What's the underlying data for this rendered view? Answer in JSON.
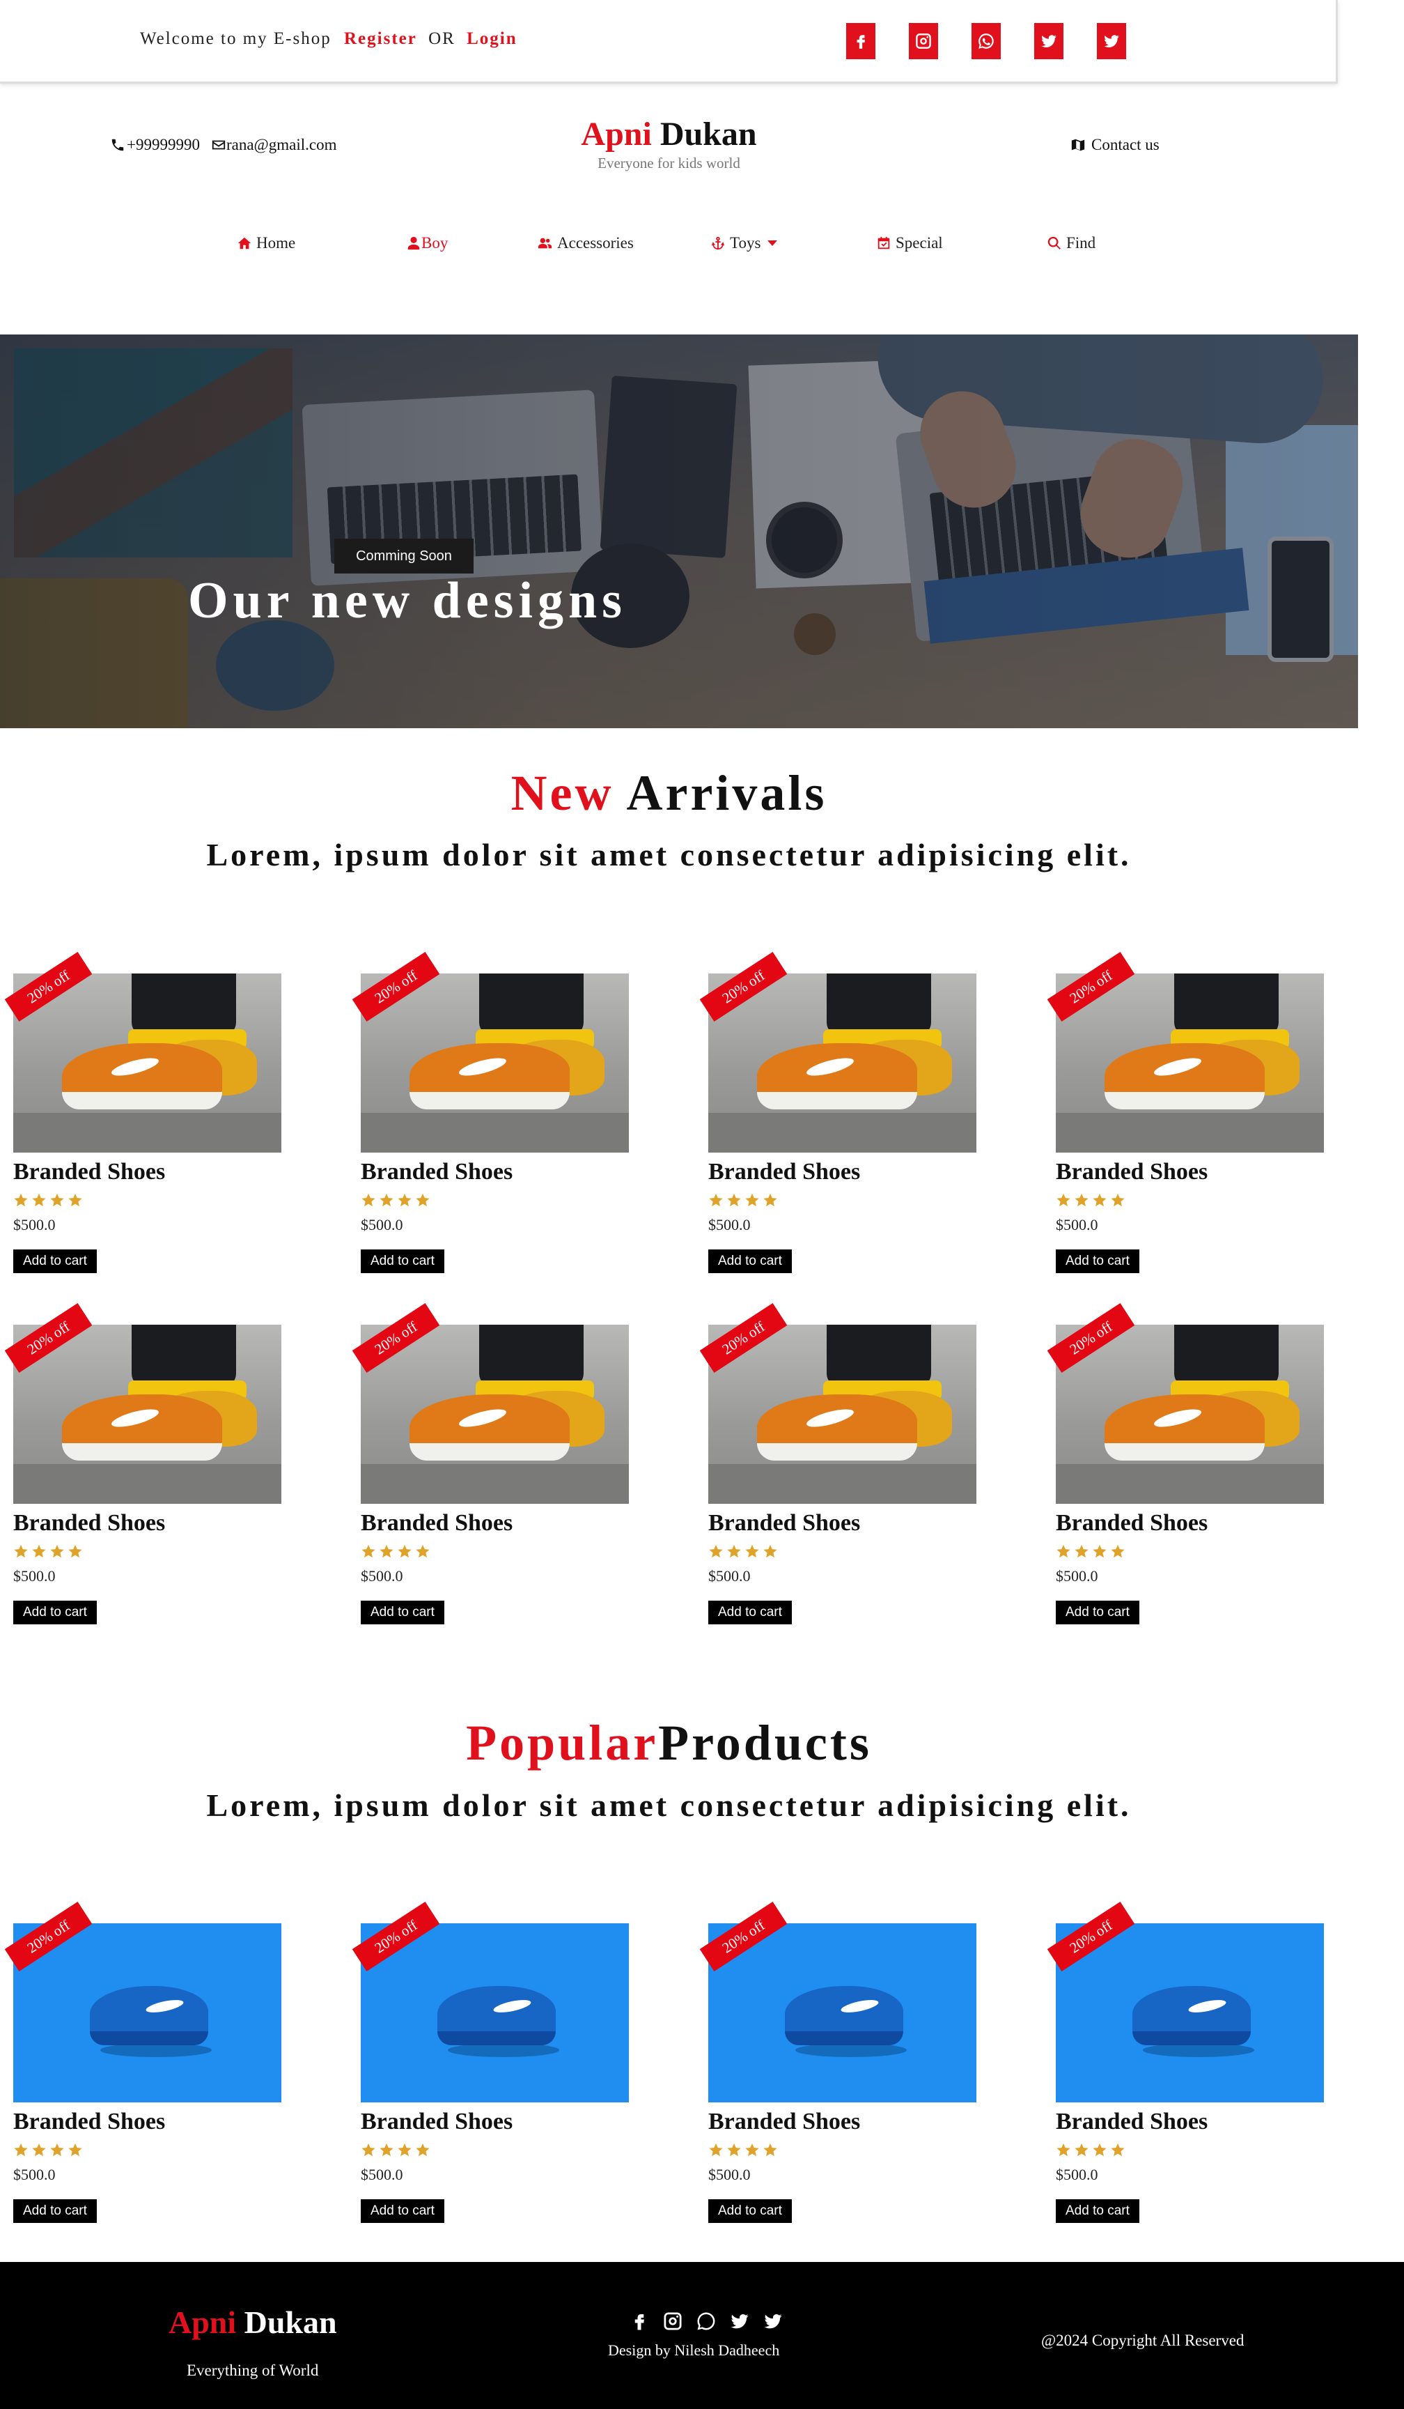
{
  "topbar": {
    "welcome": "Welcome to my E-shop",
    "register": "Register",
    "or": "OR",
    "login": "Login",
    "socials": [
      "facebook-icon",
      "instagram-icon",
      "whatsapp-icon",
      "twitter-icon",
      "twitter-icon"
    ]
  },
  "header": {
    "phone": "+99999990",
    "email": "rana@gmail.com",
    "brand_first": "Apni",
    "brand_second": "Dukan",
    "tagline": "Everyone for kids world",
    "contact": "Contact us"
  },
  "nav": {
    "home": "Home",
    "boy": "Boy",
    "accessories": "Accessories",
    "toys": "Toys",
    "special": "Special",
    "find": "Find"
  },
  "hero": {
    "badge": "Comming Soon",
    "headline": "Our new designs"
  },
  "new_arrivals": {
    "title_red": "New",
    "title_black": "Arrivals",
    "subtitle": "Lorem, ipsum dolor sit amet consectetur adipisicing elit."
  },
  "popular": {
    "title_red": "Popular",
    "title_black": "Products",
    "subtitle": "Lorem, ipsum dolor sit amet consectetur adipisicing elit."
  },
  "product": {
    "ribbon": "20% off",
    "name": "Branded Shoes",
    "rating": 4,
    "price": "$500.0",
    "button": "Add to cart"
  },
  "footer": {
    "brand_first": "Apni",
    "brand_second": "Dukan",
    "tagline": "Everything of World",
    "design": "Design by Nilesh Dadheech",
    "copyright": "@2024 Copyright All Reserved"
  },
  "colors": {
    "accent": "#e0101d",
    "star": "#e0a32a",
    "footer": "#000000"
  }
}
